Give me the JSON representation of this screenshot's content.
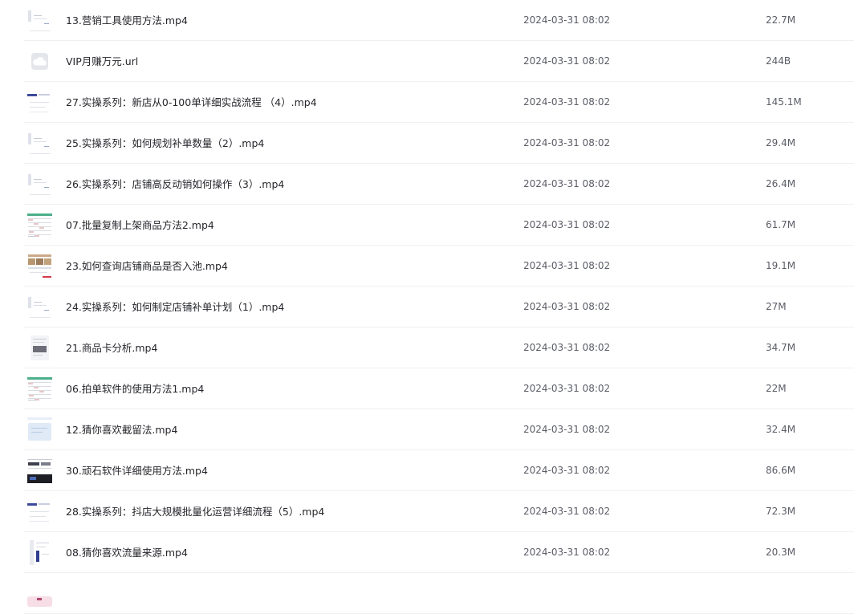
{
  "files": [
    {
      "name": "13.营销工具使用方法.mp4",
      "modified": "2024-03-31 08:02",
      "size": "22.7M",
      "thumb": "video-thumbnail",
      "style": "sparse"
    },
    {
      "name": "VIP月赚万元.url",
      "modified": "2024-03-31 08:02",
      "size": "244B",
      "thumb": "cloud-link-icon",
      "style": "cloud"
    },
    {
      "name": "27.实操系列：新店从0-100单详细实战流程 （4）.mp4",
      "modified": "2024-03-31 08:02",
      "size": "145.1M",
      "thumb": "video-thumbnail",
      "style": "bluebar"
    },
    {
      "name": "25.实操系列：如何规划补单数量（2）.mp4",
      "modified": "2024-03-31 08:02",
      "size": "29.4M",
      "thumb": "video-thumbnail",
      "style": "sparse"
    },
    {
      "name": "26.实操系列：店铺高反动销如何操作（3）.mp4",
      "modified": "2024-03-31 08:02",
      "size": "26.4M",
      "thumb": "video-thumbnail",
      "style": "sparse"
    },
    {
      "name": "07.批量复制上架商品方法2.mp4",
      "modified": "2024-03-31 08:02",
      "size": "61.7M",
      "thumb": "video-thumbnail",
      "style": "table"
    },
    {
      "name": "23.如何查询店铺商品是否入池.mp4",
      "modified": "2024-03-31 08:02",
      "size": "19.1M",
      "thumb": "video-thumbnail",
      "style": "photos"
    },
    {
      "name": "24.实操系列：如何制定店铺补单计划（1）.mp4",
      "modified": "2024-03-31 08:02",
      "size": "27M",
      "thumb": "video-thumbnail",
      "style": "sparse"
    },
    {
      "name": "21.商品卡分析.mp4",
      "modified": "2024-03-31 08:02",
      "size": "34.7M",
      "thumb": "video-thumbnail",
      "style": "doc"
    },
    {
      "name": "06.拍单软件的使用方法1.mp4",
      "modified": "2024-03-31 08:02",
      "size": "22M",
      "thumb": "video-thumbnail",
      "style": "table"
    },
    {
      "name": "12.猜你喜欢截留法.mp4",
      "modified": "2024-03-31 08:02",
      "size": "32.4M",
      "thumb": "video-thumbnail",
      "style": "lightblue"
    },
    {
      "name": "30.顽石软件详细使用方法.mp4",
      "modified": "2024-03-31 08:02",
      "size": "86.6M",
      "thumb": "video-thumbnail",
      "style": "dark"
    },
    {
      "name": "28.实操系列：抖店大规模批量化运营详细流程（5）.mp4",
      "modified": "2024-03-31 08:02",
      "size": "72.3M",
      "thumb": "video-thumbnail",
      "style": "bluebar"
    },
    {
      "name": "08.猜你喜欢流量来源.mp4",
      "modified": "2024-03-31 08:02",
      "size": "20.3M",
      "thumb": "video-thumbnail",
      "style": "sidebar"
    },
    {
      "name": "",
      "modified": "",
      "size": "",
      "thumb": "video-thumbnail",
      "style": "pink"
    }
  ]
}
